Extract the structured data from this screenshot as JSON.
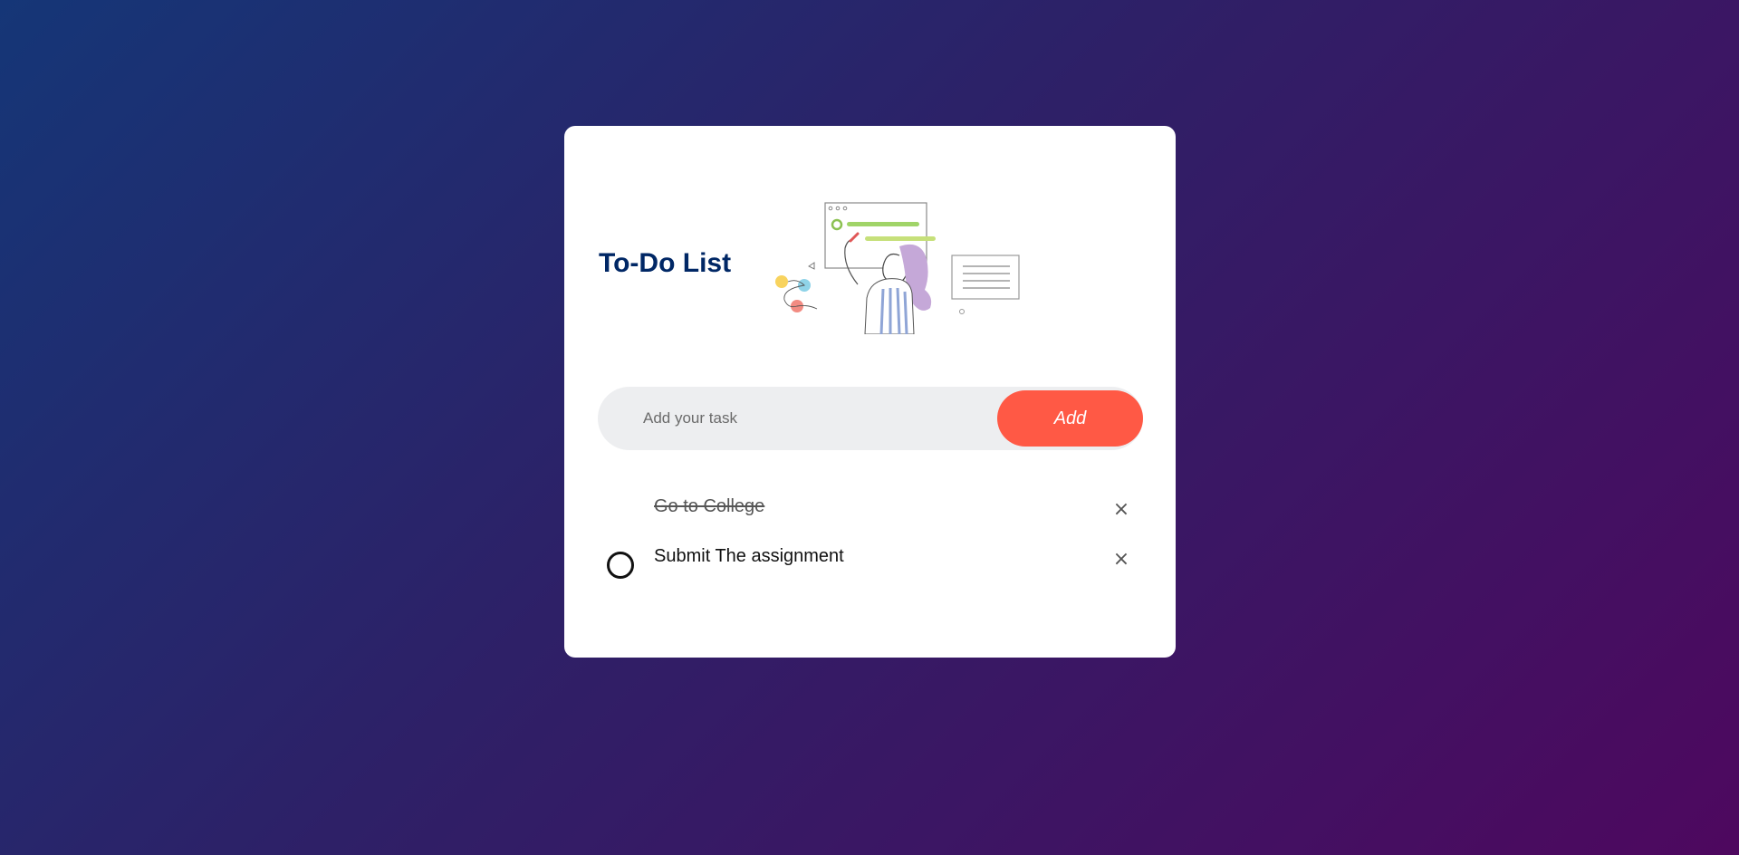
{
  "app": {
    "title": "To-Do List"
  },
  "input": {
    "placeholder": "Add your task",
    "value": "",
    "add_label": "Add"
  },
  "tasks": [
    {
      "text": "Go to College",
      "done": true,
      "remove_label": "×"
    },
    {
      "text": "Submit The assignment",
      "done": false,
      "remove_label": "×"
    }
  ],
  "icons": {
    "illustration": "woman-writing-checklist-illustration",
    "check": "circle-checkbox-icon",
    "remove": "close-icon"
  },
  "colors": {
    "title": "#002765",
    "accent": "#ff5945",
    "input_bg": "#edeef0",
    "bg_start": "#153677",
    "bg_end": "#4e085f"
  }
}
